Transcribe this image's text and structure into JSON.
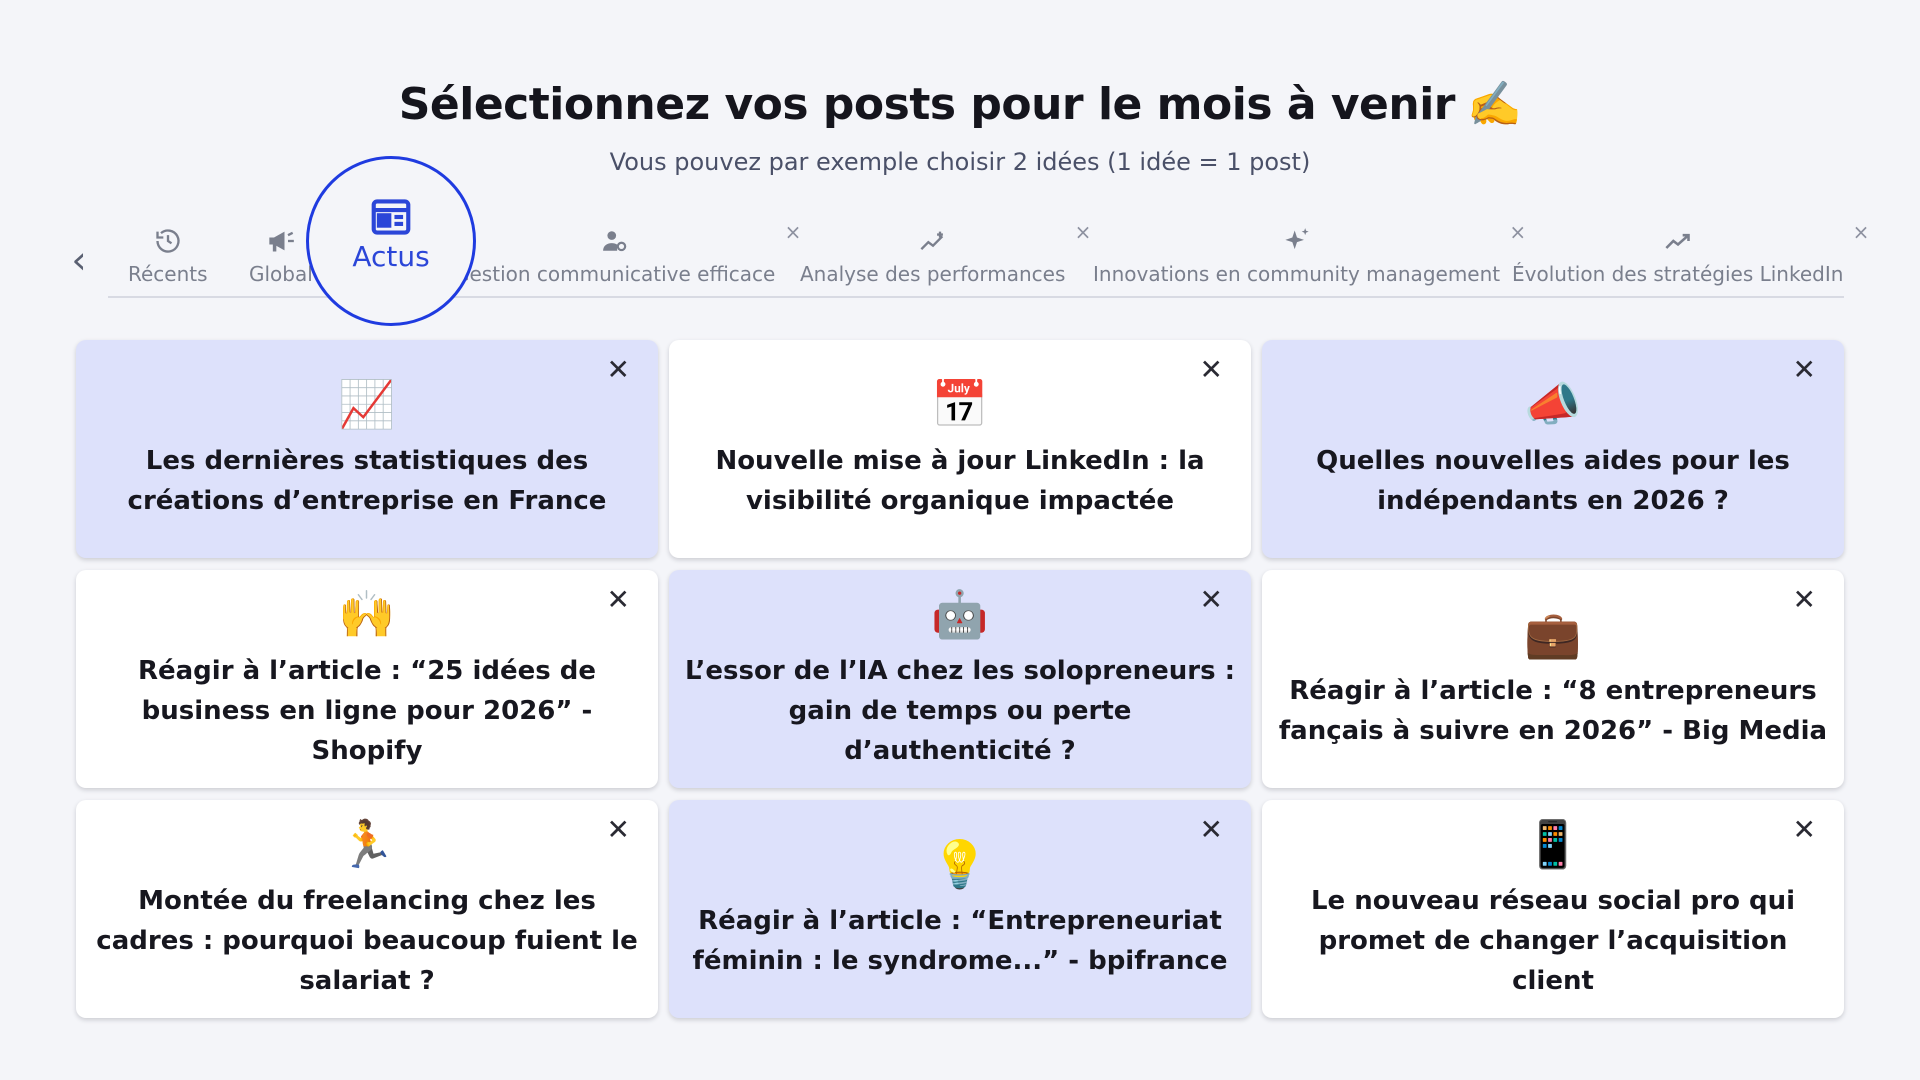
{
  "header": {
    "title": "Sélectionnez vos posts pour le mois à venir",
    "title_emoji": "✍️",
    "subtitle": "Vous pouvez par exemple choisir 2 idées (1 idée = 1 post)"
  },
  "tabs": {
    "prev_icon": "chevron-left-icon",
    "items": [
      {
        "label": "Récents",
        "icon": "history-icon"
      },
      {
        "label": "Global",
        "icon": "megaphone-icon"
      },
      {
        "label": "Actus",
        "icon": "newspaper-icon",
        "active": true
      },
      {
        "label": "Gestion communicative efficace",
        "icon": "user-gear-icon",
        "close": "×"
      },
      {
        "label": "Analyse des performances",
        "icon": "trend-sparkle-icon",
        "close": "×"
      },
      {
        "label": "Innovations en community management",
        "icon": "sparkles-icon",
        "close": "×"
      },
      {
        "label": "Évolution des stratégies LinkedIn",
        "icon": "trend-line-icon",
        "close": "×"
      }
    ]
  },
  "cards": [
    {
      "emoji": "📈",
      "text": "Les dernières statistiques des créations d’entreprise en France",
      "style": "tinted",
      "close": "✕"
    },
    {
      "emoji": "📅",
      "text": "Nouvelle mise à jour LinkedIn : la visibilité organique impactée",
      "style": "white",
      "close": "✕"
    },
    {
      "emoji": "📣",
      "text": "Quelles nouvelles aides pour les indépendants en 2026 ?",
      "style": "tinted",
      "close": "✕"
    },
    {
      "emoji": "🙌",
      "text": "Réagir à l’article : “25 idées de business en ligne pour 2026” - Shopify",
      "style": "white",
      "close": "✕"
    },
    {
      "emoji": "🤖",
      "text": "L’essor de l’IA chez les solopreneurs : gain de temps ou perte d’authenticité ?",
      "style": "tinted",
      "close": "✕"
    },
    {
      "emoji": "💼",
      "text": "Réagir à l’article : “8 entrepreneurs fançais à suivre en 2026” - Big Media",
      "style": "white",
      "close": "✕"
    },
    {
      "emoji": "🏃",
      "text": "Montée du freelancing chez les cadres : pourquoi beaucoup fuient le salariat ?",
      "style": "white",
      "close": "✕"
    },
    {
      "emoji": "💡",
      "text": "Réagir à l’article : “Entrepreneuriat féminin : le syndrome...” - bpifrance",
      "style": "tinted",
      "close": "✕"
    },
    {
      "emoji": "📱",
      "text": "Le nouveau réseau social pro qui promet de changer l’acquisition client",
      "style": "white",
      "close": "✕"
    }
  ]
}
